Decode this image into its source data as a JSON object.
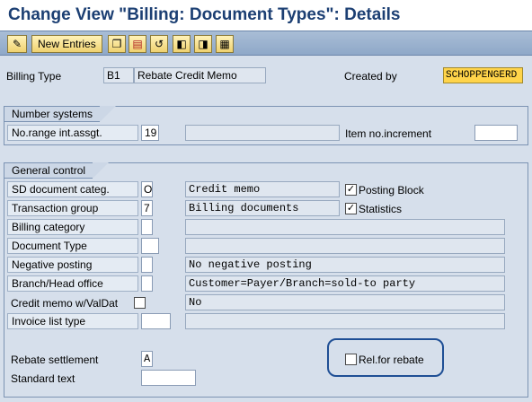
{
  "title": "Change View \"Billing: Document Types\": Details",
  "toolbar": {
    "new_entries": "New Entries",
    "icons": [
      "change-display-icon",
      "copy-icon",
      "delete-icon",
      "undo-icon",
      "previous-entry-icon",
      "next-entry-icon",
      "variable-list-icon"
    ]
  },
  "header": {
    "billing_type_label": "Billing Type",
    "billing_type_code": "B1",
    "billing_type_desc": "Rebate Credit Memo",
    "created_by_label": "Created by",
    "created_by_value": "SCHOPPENGERD"
  },
  "number_systems": {
    "title": "Number systems",
    "no_range_label": "No.range int.assgt.",
    "no_range_value": "19",
    "no_range_desc": "",
    "item_inc_label": "Item no.increment",
    "item_inc_value": ""
  },
  "general_control": {
    "title": "General control",
    "sd_doc_categ_label": "SD document categ.",
    "sd_doc_categ_value": "O",
    "sd_doc_categ_desc": "Credit memo",
    "posting_block_label": "Posting Block",
    "posting_block_checked": true,
    "transaction_group_label": "Transaction group",
    "transaction_group_value": "7",
    "transaction_group_desc": "Billing documents",
    "statistics_label": "Statistics",
    "statistics_checked": true,
    "billing_category_label": "Billing category",
    "billing_category_value": "",
    "billing_category_desc": "",
    "document_type_label": "Document Type",
    "document_type_value": "",
    "document_type_desc": "",
    "negative_posting_label": "Negative posting",
    "negative_posting_value": "",
    "negative_posting_desc": "No negative posting",
    "branch_head_label": "Branch/Head office",
    "branch_head_value": "",
    "branch_head_desc": "Customer=Payer/Branch=sold-to party",
    "credit_memo_label": "Credit memo w/ValDat",
    "credit_memo_checked": false,
    "credit_memo_desc": "No",
    "invoice_list_label": "Invoice list type",
    "invoice_list_value": "",
    "invoice_list_desc": "",
    "rebate_settlement_label": "Rebate settlement",
    "rebate_settlement_value": "A",
    "rel_for_rebate_label": "Rel.for rebate",
    "rel_for_rebate_checked": false,
    "standard_text_label": "Standard text",
    "standard_text_value": ""
  }
}
